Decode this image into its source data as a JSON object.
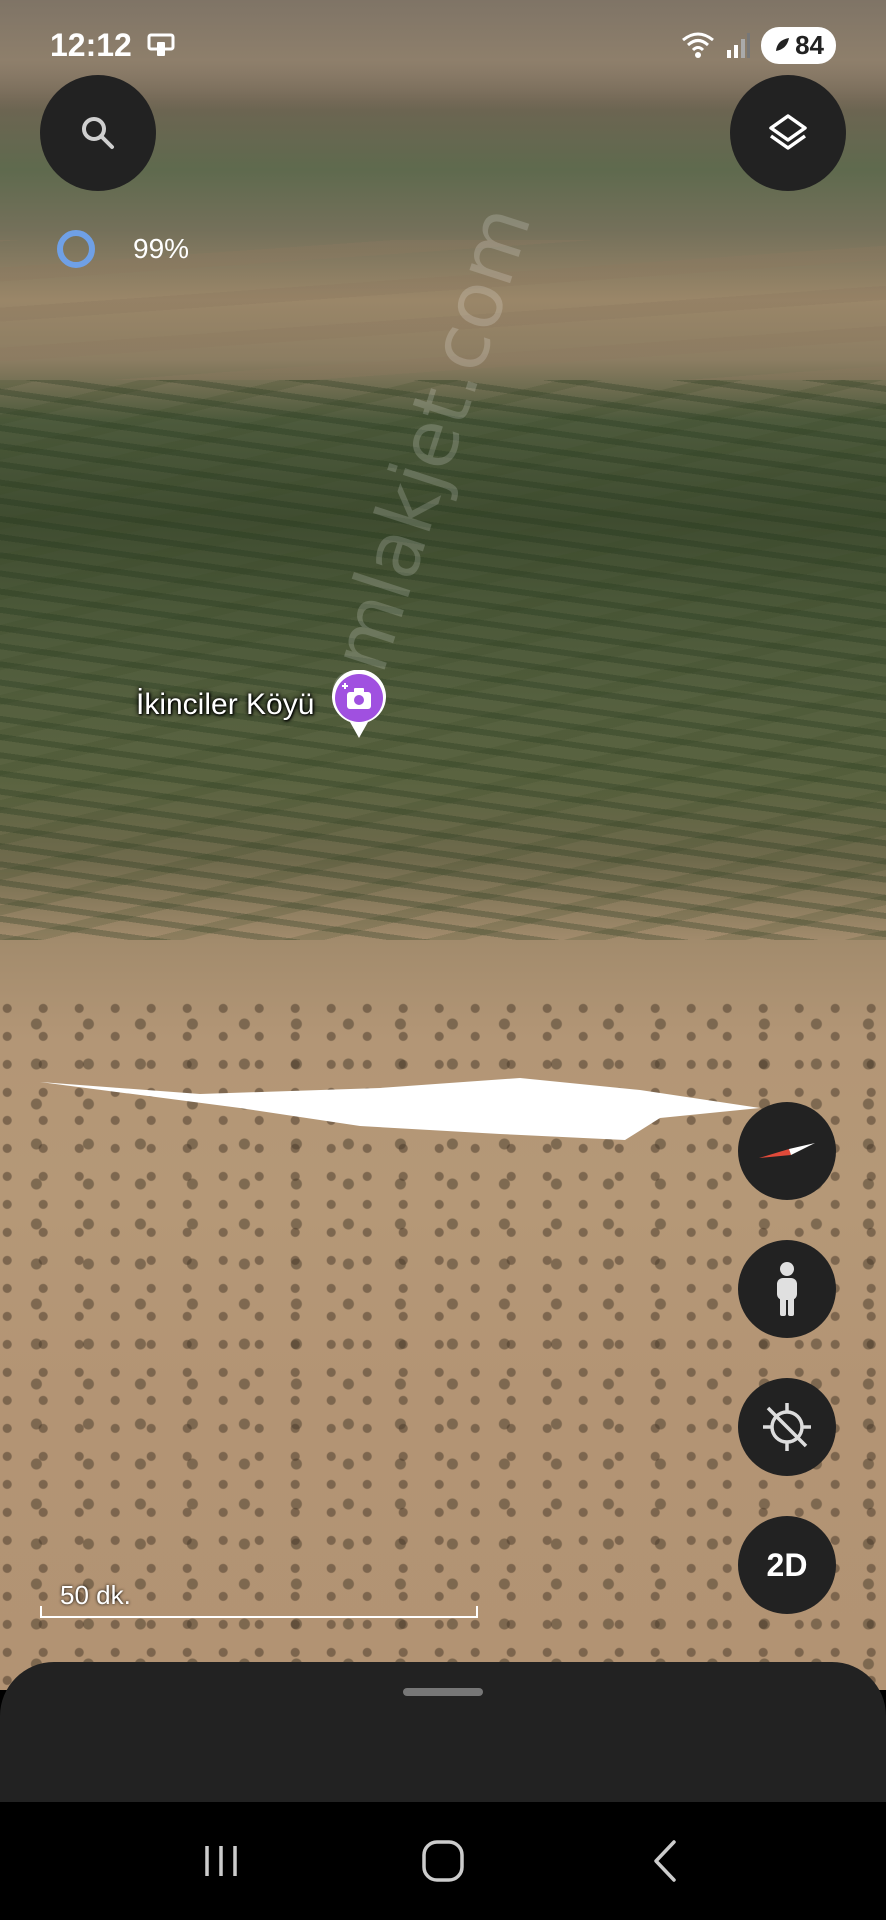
{
  "status_bar": {
    "time": "12:12",
    "battery_level": "84",
    "icons": [
      "screen-mirror-icon",
      "wifi-icon",
      "signal-icon",
      "battery-saver-icon"
    ]
  },
  "top_controls": {
    "search": {
      "icon": "search-icon"
    },
    "layers": {
      "icon": "layers-icon"
    }
  },
  "progress": {
    "value_text": "99%",
    "value": 0.99,
    "color": "#6fa0e6"
  },
  "map": {
    "place_label": "İkinciler Köyü",
    "place_pin_color": "#a050e0",
    "watermark": "emlakjet.com",
    "highlighted_parcel_color": "#ffffff"
  },
  "scale": {
    "label": "50 dk."
  },
  "side_controls": {
    "compass": {
      "icon": "compass-icon"
    },
    "street_view": {
      "icon": "pegman-icon"
    },
    "my_location": {
      "icon": "location-off-icon"
    },
    "view_mode": {
      "label": "2D"
    }
  },
  "nav_bar": {
    "items": [
      "recent-apps-icon",
      "home-icon",
      "back-icon"
    ]
  }
}
